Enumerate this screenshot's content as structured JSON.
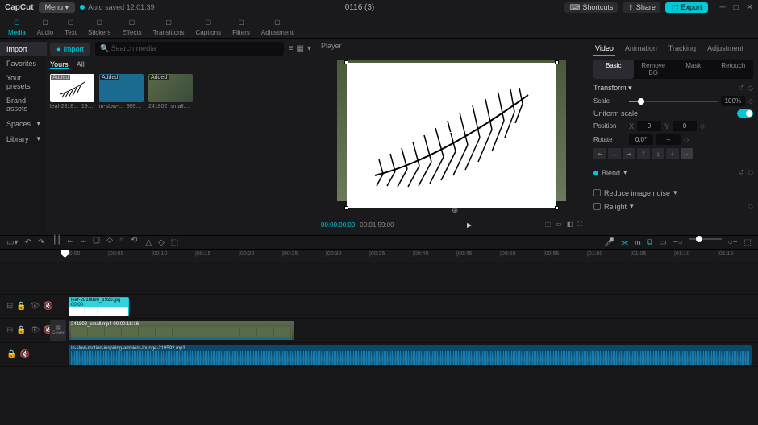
{
  "titlebar": {
    "app": "CapCut",
    "menu": "Menu",
    "autosaved": "Auto saved  12:01:39",
    "project": "0116 (3)",
    "shortcuts": "Shortcuts",
    "share": "Share",
    "export": "Export"
  },
  "ribbon": [
    {
      "label": "Media",
      "icon": "media-icon",
      "active": true
    },
    {
      "label": "Audio",
      "icon": "audio-icon"
    },
    {
      "label": "Text",
      "icon": "text-icon"
    },
    {
      "label": "Stickers",
      "icon": "stickers-icon"
    },
    {
      "label": "Effects",
      "icon": "effects-icon"
    },
    {
      "label": "Transitions",
      "icon": "transitions-icon"
    },
    {
      "label": "Captions",
      "icon": "captions-icon"
    },
    {
      "label": "Filters",
      "icon": "filters-icon"
    },
    {
      "label": "Adjustment",
      "icon": "adjustment-icon"
    }
  ],
  "sidebar": {
    "items": [
      {
        "label": "Import",
        "active": true
      },
      {
        "label": "Favorites"
      },
      {
        "label": "Your presets"
      },
      {
        "label": "Brand assets"
      },
      {
        "label": "Spaces",
        "chev": true
      },
      {
        "label": "Library",
        "chev": true
      }
    ]
  },
  "media": {
    "import": "Import",
    "search_placeholder": "Search media",
    "filters": {
      "yours": "Yours",
      "all": "All"
    },
    "thumbs": [
      {
        "badge": "Added",
        "label": "leaf-2818..._1920.jpg",
        "kind": "leaf"
      },
      {
        "badge": "Added",
        "label": "in-slow-..._9592.mp3",
        "kind": "audio"
      },
      {
        "badge": "Added",
        "label": "241802_small.mp4",
        "kind": "video"
      }
    ]
  },
  "player": {
    "title": "Player",
    "tc_current": "00:00:00:00",
    "tc_duration": "00:01:59:00"
  },
  "inspector": {
    "tabs": [
      "Video",
      "Animation",
      "Tracking",
      "Adjustment"
    ],
    "subtabs": [
      "Basic",
      "Remove BG",
      "Mask",
      "Retouch"
    ],
    "transform": "Transform",
    "scale": {
      "label": "Scale",
      "value": "100%"
    },
    "uniform": "Uniform scale",
    "position": "Position",
    "pos_x": "0",
    "pos_y": "0",
    "rotate": "Rotate",
    "rotate_val": "0.0°",
    "blend": "Blend",
    "noise": "Reduce image noise",
    "relight": "Relight"
  },
  "timeline": {
    "ruler": [
      "00:00",
      "00:05",
      "00:10",
      "00:15",
      "00:20",
      "00:25",
      "00:30",
      "00:35",
      "00:40",
      "00:45",
      "00:50",
      "00:55",
      "01:00",
      "01:05",
      "01:10",
      "01:15"
    ],
    "cover": "Cover",
    "clip_img": "leaf-2818896_1920.jpg   00:00",
    "clip_vid": "241802_small.mp4  00:00:18:16",
    "clip_aud": "in-slow-motion-inspiring-ambient-lounge-219592.mp3"
  }
}
